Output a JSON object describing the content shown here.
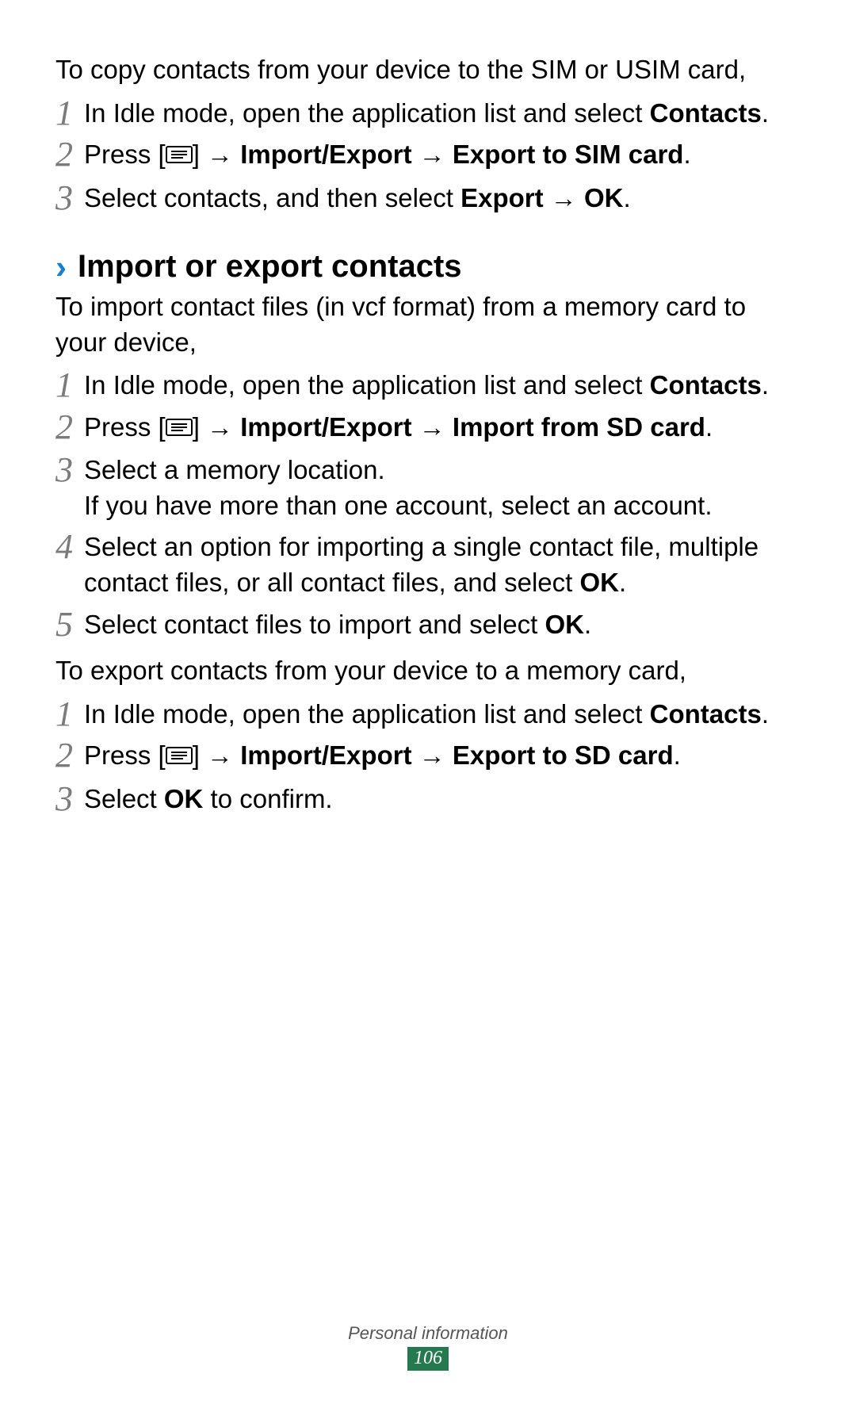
{
  "intro1": "To copy contacts from your device to the SIM or USIM card,",
  "copy_steps": [
    {
      "num": "1",
      "text_a": "In Idle mode, open the application list and select ",
      "bold_a": "Contacts",
      "text_b": "."
    },
    {
      "num": "2",
      "text_a": "Press [",
      "icon": true,
      "text_b": "] ",
      "arrow1": "→ ",
      "bold_b": "Import/Export",
      "arrow2": " → ",
      "bold_c": "Export to SIM card",
      "text_c": "."
    },
    {
      "num": "3",
      "text_a": "Select contacts, and then select ",
      "bold_a": "Export",
      "arrow1": " → ",
      "bold_b": "OK",
      "text_b": "."
    }
  ],
  "heading_chevron": "›",
  "heading": "Import or export contacts",
  "intro2": "To import contact files (in vcf format) from a memory card to your device,",
  "import_steps": [
    {
      "num": "1",
      "text_a": "In Idle mode, open the application list and select ",
      "bold_a": "Contacts",
      "text_b": "."
    },
    {
      "num": "2",
      "text_a": "Press [",
      "icon": true,
      "text_b": "] ",
      "arrow1": "→ ",
      "bold_b": "Import/Export",
      "arrow2": " → ",
      "bold_c": "Import from SD card",
      "text_c": "."
    },
    {
      "num": "3",
      "line1": "Select a memory location.",
      "line2": "If you have more than one account, select an account."
    },
    {
      "num": "4",
      "text_a": "Select an option for importing a single contact file, multiple contact files, or all contact files, and select ",
      "bold_a": "OK",
      "text_b": "."
    },
    {
      "num": "5",
      "text_a": "Select contact files to import and select ",
      "bold_a": "OK",
      "text_b": "."
    }
  ],
  "intro3": "To export contacts from your device to a memory card,",
  "export_steps": [
    {
      "num": "1",
      "text_a": "In Idle mode, open the application list and select ",
      "bold_a": "Contacts",
      "text_b": "."
    },
    {
      "num": "2",
      "text_a": "Press [",
      "icon": true,
      "text_b": "] ",
      "arrow1": "→ ",
      "bold_b": "Import/Export",
      "arrow2": " → ",
      "bold_c": "Export to SD card",
      "text_c": "."
    },
    {
      "num": "3",
      "text_a": "Select ",
      "bold_a": "OK",
      "text_b": " to confirm."
    }
  ],
  "footer_label": "Personal information",
  "page_number": "106"
}
